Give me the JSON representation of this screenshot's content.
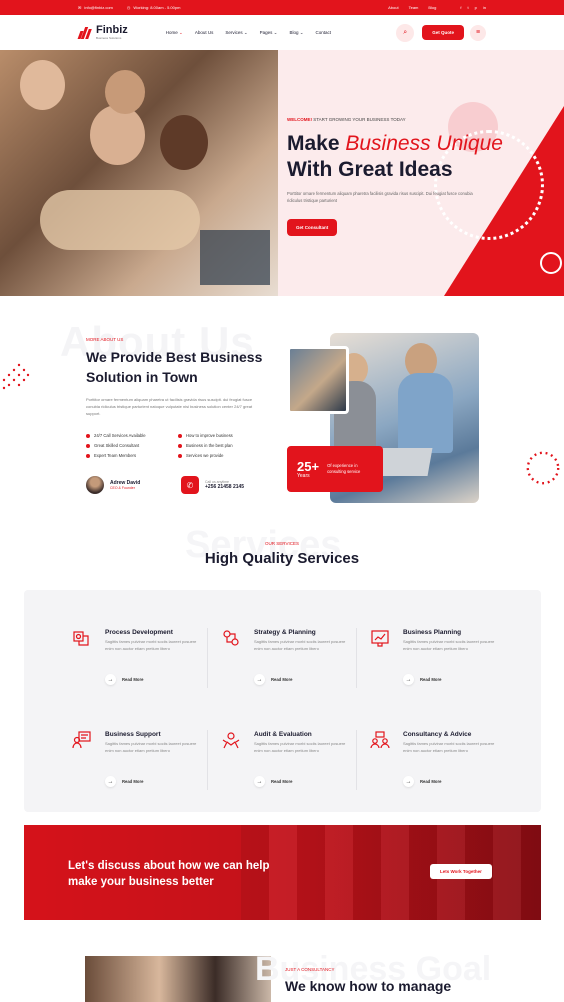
{
  "topbar": {
    "email": "info@finbiz.com",
    "hours": "Working: 8.00am - 5.00pm",
    "links": [
      "About",
      "Team",
      "Blog"
    ],
    "social": [
      "f",
      "t",
      "p",
      "in"
    ]
  },
  "header": {
    "brand": "Finbiz",
    "tagline": "Business Solutions",
    "nav": [
      "Home",
      "About Us",
      "Services",
      "Pages",
      "Blog",
      "Contact"
    ],
    "search_icon": "⌕",
    "quote_label": "Get Quote",
    "menu_icon": "≡"
  },
  "hero": {
    "kicker_strong": "WELCOME!",
    "kicker_rest": " START GROWING YOUR BUSINESS TODAY",
    "title_1": "Make ",
    "title_1_accent": "Business Unique",
    "title_2": "With Great Ideas",
    "desc": "Porttitor ornare fermentum aliquam pharetra facilisis gravida risus suscipit. Dui feugiat fusce conubia ridiculus tristique parturient",
    "cta": "Get Consultant"
  },
  "about": {
    "ghost": "About Us",
    "kicker": "MORE ABOUT US",
    "title": "We Provide Best Business Solution in Town",
    "desc": "Porttitor ornare fermentum aliquam pharetra ut facilisis gravida risus suscipit. dui feugiat fusce conubia ridiculus tristique parturient natoque vulputate nisi business solution center 24/7 great support.",
    "features": [
      "24/7 Call Services Available",
      "Great Skilled Consultant",
      "Expert Team Members",
      "How to improve business",
      "Business in the best plan",
      "Services we provide"
    ],
    "author_name": "Adrew David",
    "author_role": "CEO & Founder",
    "call_label": "Call us anytime",
    "call_number": "+256 21458 2145",
    "badge_num": "25+",
    "badge_unit": "Years",
    "badge_text": "Of experience in consulting service"
  },
  "services": {
    "ghost": "Services",
    "kicker": "OUR SERVICES",
    "title": "High Quality Services",
    "read_more": "Read More",
    "desc": "Sagittis fames pulvinar morbi sociis laoreet posuere enim non auctor etiam pretium libero",
    "items": [
      {
        "title": "Process Development",
        "icon": "process-icon"
      },
      {
        "title": "Strategy & Planning",
        "icon": "strategy-icon"
      },
      {
        "title": "Business Planning",
        "icon": "planning-icon"
      },
      {
        "title": "Business Support",
        "icon": "support-icon"
      },
      {
        "title": "Audit & Evaluation",
        "icon": "audit-icon"
      },
      {
        "title": "Consultancy & Advice",
        "icon": "consultancy-icon"
      }
    ]
  },
  "cta": {
    "text": "Let's discuss about how we can help make your business better",
    "button": "Lets Work Together"
  },
  "bottom": {
    "ghost": "Business Goal",
    "kicker": "JUST A CONSULTANCY",
    "title": "We know how to manage"
  },
  "colors": {
    "accent": "#e2141c",
    "dark": "#1b1b2f",
    "pale": "#fcebec"
  }
}
